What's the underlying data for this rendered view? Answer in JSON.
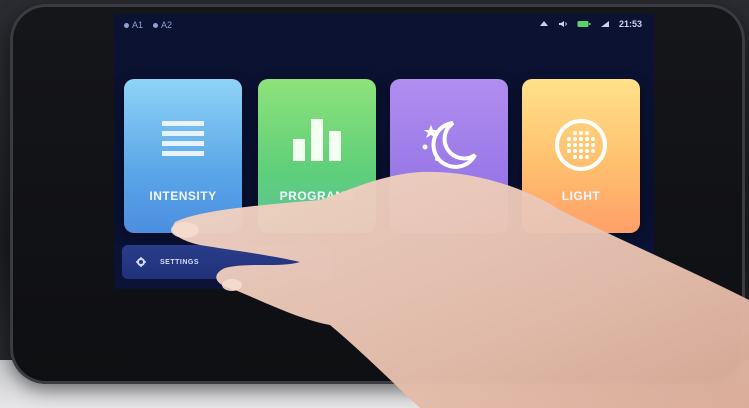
{
  "status": {
    "a1": "A1",
    "a2": "A2",
    "time": "21:53"
  },
  "tiles": [
    {
      "label": "INTENSITY",
      "icon": "menu-lines-icon"
    },
    {
      "label": "PROGRAMS",
      "icon": "bar-chart-icon"
    },
    {
      "label": "",
      "icon": "moon-stars-icon"
    },
    {
      "label": "LIGHT",
      "icon": "light-dots-icon"
    }
  ],
  "settings": {
    "label": "SETTINGS",
    "icon": "gear-icon"
  },
  "colors": {
    "screen_bg": "#0b1232",
    "intensity": "#6bb6ef",
    "programs": "#6fd57c",
    "night": "#a07ff0",
    "light": "#ffb870",
    "settings_bar": "#24378a"
  }
}
